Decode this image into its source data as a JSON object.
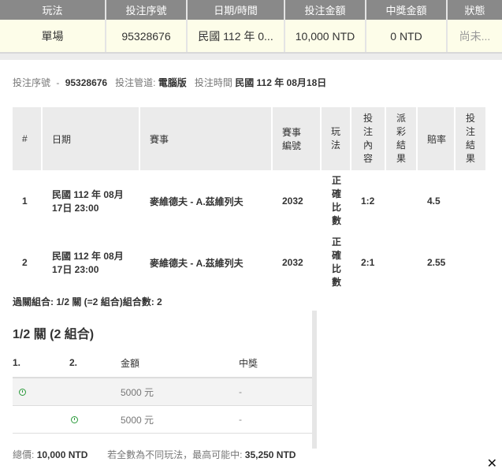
{
  "summary": {
    "headers": [
      "玩法",
      "投注序號",
      "日期/時間",
      "投注金額",
      "中獎金額",
      "狀態"
    ],
    "row": [
      "單場",
      "95328676",
      "民國 112 年 0...",
      "10,000 NTD",
      "0 NTD",
      "尚未..."
    ]
  },
  "info": {
    "serial_label": "投注序號",
    "serial_value": "95328676",
    "channel_label": "投注管道:",
    "channel_value": "電腦版",
    "time_label": "投注時間",
    "time_value": "民國 112 年 08月18日"
  },
  "bets": {
    "headers": [
      "#",
      "日期",
      "賽事",
      "賽事編號",
      "玩法",
      "投注內容",
      "派彩結果",
      "賠率",
      "投注結果"
    ],
    "rows": [
      {
        "no": "1",
        "date": "民國 112 年 08月 17日 23:00",
        "match": "麥維德夫 - A.茲維列夫",
        "match_id": "2032",
        "type": "正確比數",
        "content": "1:2",
        "payout": "",
        "odds": "4.5",
        "result": ""
      },
      {
        "no": "2",
        "date": "民國 112 年 08月 17日 23:00",
        "match": "麥維德夫 - A.茲維列夫",
        "match_id": "2032",
        "type": "正確比數",
        "content": "2:1",
        "payout": "",
        "odds": "2.55",
        "result": ""
      }
    ]
  },
  "combo_summary": "過關組合: 1/2 關 (=2 組合)組合數: 2",
  "combo": {
    "title": "1/2 關 (2 組合)",
    "headers": [
      "1.",
      "2.",
      "金額",
      "中獎"
    ],
    "rows": [
      {
        "amount": "5000 元",
        "win": "-"
      },
      {
        "amount": "5000 元",
        "win": "-"
      }
    ]
  },
  "total": {
    "label": "總價:",
    "value": "10,000 NTD",
    "note": "若全數為不同玩法，最高可能中:",
    "max": "35,250 NTD"
  },
  "close_label": "✕"
}
